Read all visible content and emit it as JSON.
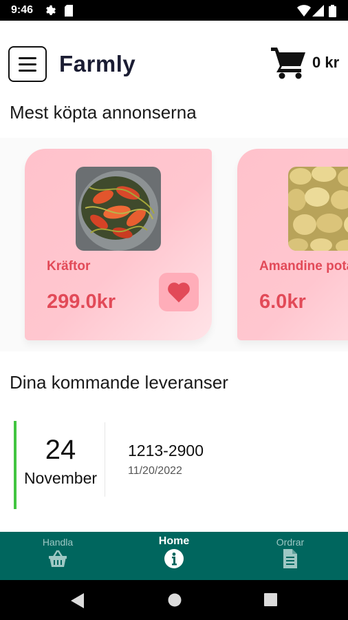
{
  "status_bar": {
    "time": "9:46",
    "icons": [
      "gear-icon",
      "sim-card-icon",
      "wifi-icon",
      "signal-icon",
      "battery-icon"
    ]
  },
  "app_bar": {
    "title": "Farmly",
    "menu_icon": "hamburger-menu-icon",
    "cart_icon": "shopping-cart-icon",
    "cart_total": "0 kr"
  },
  "popular": {
    "title": "Mest köpta annonserna",
    "items": [
      {
        "name": "Kräftor",
        "price": "299.0kr",
        "image": "crayfish-photo",
        "favorite_icon": "heart-icon"
      },
      {
        "name": "Amandine potatis",
        "price": "6.0kr",
        "image": "potatoes-photo"
      }
    ]
  },
  "deliveries": {
    "title": "Dina kommande leveranser",
    "items": [
      {
        "day": "24",
        "month": "November",
        "order_number": "1213-2900",
        "date": "11/20/2022"
      }
    ]
  },
  "bottom_nav": {
    "items": [
      {
        "label": "Handla",
        "icon": "basket-icon",
        "active": false
      },
      {
        "label": "Home",
        "icon": "info-icon",
        "active": true
      },
      {
        "label": "Ordrar",
        "icon": "document-icon",
        "active": false
      }
    ]
  },
  "system_nav": {
    "icons": [
      "back-icon",
      "home-icon",
      "recents-icon"
    ]
  },
  "colors": {
    "accent_pink": "#e24a58",
    "card_pink": "#ffc6cf",
    "nav_teal": "#00665e",
    "delivery_green": "#41c540"
  }
}
